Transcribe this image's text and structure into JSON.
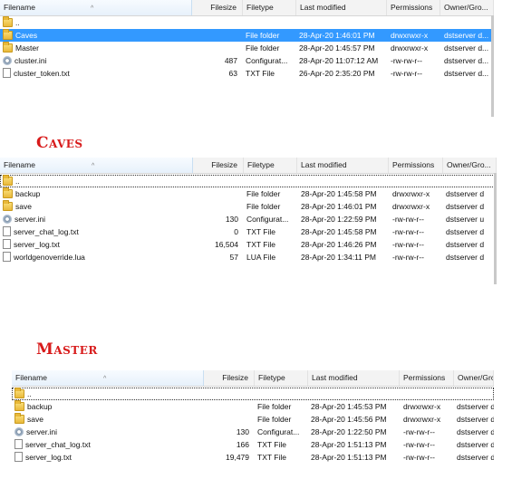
{
  "columns": {
    "filename": "Filename",
    "filesize": "Filesize",
    "filetype": "Filetype",
    "modified": "Last modified",
    "perms": "Permissions",
    "owner": "Owner/Gro..."
  },
  "panel1": {
    "rows": [
      {
        "name": "..",
        "size": "",
        "type": "",
        "modified": "",
        "perms": "",
        "owner": "",
        "icon": "folder-icon"
      },
      {
        "name": "Caves",
        "size": "",
        "type": "File folder",
        "modified": "28-Apr-20 1:46:01 PM",
        "perms": "drwxrwxr-x",
        "owner": "dstserver d...",
        "icon": "folder-icon"
      },
      {
        "name": "Master",
        "size": "",
        "type": "File folder",
        "modified": "28-Apr-20 1:45:57 PM",
        "perms": "drwxrwxr-x",
        "owner": "dstserver d...",
        "icon": "folder-icon"
      },
      {
        "name": "cluster.ini",
        "size": "487",
        "type": "Configurat...",
        "modified": "28-Apr-20 11:07:12 AM",
        "perms": "-rw-rw-r--",
        "owner": "dstserver d...",
        "icon": "gear-icon"
      },
      {
        "name": "cluster_token.txt",
        "size": "63",
        "type": "TXT File",
        "modified": "26-Apr-20 2:35:20 PM",
        "perms": "-rw-rw-r--",
        "owner": "dstserver d...",
        "icon": "file-icon"
      }
    ]
  },
  "caves": {
    "title": "Caves",
    "rows": [
      {
        "name": "..",
        "size": "",
        "type": "",
        "modified": "",
        "perms": "",
        "owner": "",
        "icon": "folder-icon"
      },
      {
        "name": "backup",
        "size": "",
        "type": "File folder",
        "modified": "28-Apr-20 1:45:58 PM",
        "perms": "drwxrwxr-x",
        "owner": "dstserver d",
        "icon": "folder-icon"
      },
      {
        "name": "save",
        "size": "",
        "type": "File folder",
        "modified": "28-Apr-20 1:46:01 PM",
        "perms": "drwxrwxr-x",
        "owner": "dstserver d",
        "icon": "folder-icon"
      },
      {
        "name": "server.ini",
        "size": "130",
        "type": "Configurat...",
        "modified": "28-Apr-20 1:22:59 PM",
        "perms": "-rw-rw-r--",
        "owner": "dstserver u",
        "icon": "gear-icon"
      },
      {
        "name": "server_chat_log.txt",
        "size": "0",
        "type": "TXT File",
        "modified": "28-Apr-20 1:45:58 PM",
        "perms": "-rw-rw-r--",
        "owner": "dstserver d",
        "icon": "file-icon"
      },
      {
        "name": "server_log.txt",
        "size": "16,504",
        "type": "TXT File",
        "modified": "28-Apr-20 1:46:26 PM",
        "perms": "-rw-rw-r--",
        "owner": "dstserver d",
        "icon": "file-icon"
      },
      {
        "name": "worldgenoverride.lua",
        "size": "57",
        "type": "LUA File",
        "modified": "28-Apr-20 1:34:11 PM",
        "perms": "-rw-rw-r--",
        "owner": "dstserver d",
        "icon": "file-icon"
      }
    ]
  },
  "master": {
    "title": "Master",
    "rows": [
      {
        "name": "..",
        "size": "",
        "type": "",
        "modified": "",
        "perms": "",
        "owner": "",
        "icon": "folder-icon"
      },
      {
        "name": "backup",
        "size": "",
        "type": "File folder",
        "modified": "28-Apr-20 1:45:53 PM",
        "perms": "drwxrwxr-x",
        "owner": "dstserver d",
        "icon": "folder-icon"
      },
      {
        "name": "save",
        "size": "",
        "type": "File folder",
        "modified": "28-Apr-20 1:45:56 PM",
        "perms": "drwxrwxr-x",
        "owner": "dstserver d",
        "icon": "folder-icon"
      },
      {
        "name": "server.ini",
        "size": "130",
        "type": "Configurat...",
        "modified": "28-Apr-20 1:22:50 PM",
        "perms": "-rw-rw-r--",
        "owner": "dstserver d",
        "icon": "gear-icon"
      },
      {
        "name": "server_chat_log.txt",
        "size": "166",
        "type": "TXT File",
        "modified": "28-Apr-20 1:51:13 PM",
        "perms": "-rw-rw-r--",
        "owner": "dstserver d",
        "icon": "file-icon"
      },
      {
        "name": "server_log.txt",
        "size": "19,479",
        "type": "TXT File",
        "modified": "28-Apr-20 1:51:13 PM",
        "perms": "-rw-rw-r--",
        "owner": "dstserver d",
        "icon": "file-icon"
      }
    ]
  },
  "colors": {
    "selection": "#3399ff",
    "title": "#d81b1b"
  }
}
